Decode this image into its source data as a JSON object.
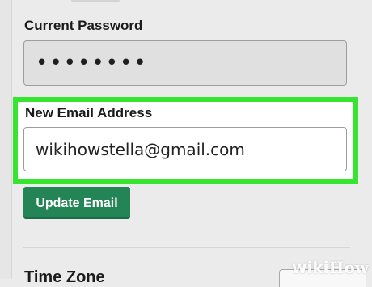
{
  "form": {
    "current_password": {
      "label": "Current Password",
      "masked_value": "••••••••"
    },
    "new_email": {
      "label": "New Email Address",
      "value": "wikihowstella@gmail.com"
    },
    "update_button_label": "Update Email",
    "time_zone_label": "Time Zone"
  },
  "watermark": {
    "wiki": "wiki",
    "how": "How"
  },
  "colors": {
    "highlight": "#35e52e",
    "button": "#238456",
    "page_background": "#ebebeb"
  }
}
